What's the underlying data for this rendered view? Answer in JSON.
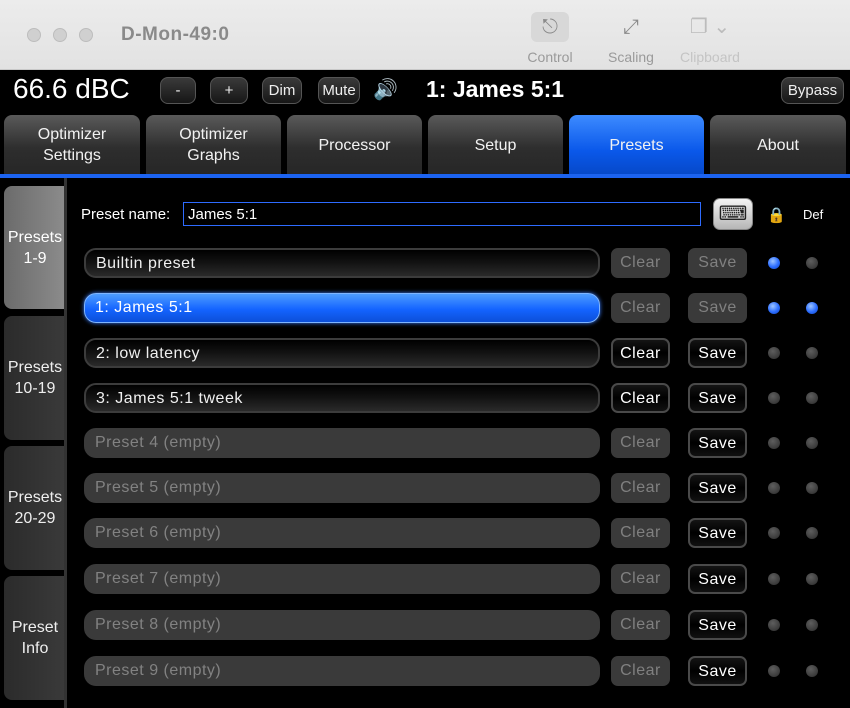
{
  "window": {
    "title": "D-Mon-49:0"
  },
  "toolbar": {
    "control_label": "Control",
    "scaling_label": "Scaling",
    "clipboard_label": "Clipboard"
  },
  "status": {
    "level": "66.6 dBC",
    "minus_label": "-",
    "plus_label": "+",
    "dim_label": "Dim",
    "mute_label": "Mute",
    "current_preset": "1: James 5:1",
    "bypass_label": "Bypass"
  },
  "tabs": [
    {
      "line1": "Optimizer",
      "line2": "Settings"
    },
    {
      "line1": "Optimizer",
      "line2": "Graphs"
    },
    {
      "line1": "Processor",
      "line2": ""
    },
    {
      "line1": "Setup",
      "line2": ""
    },
    {
      "line1": "Presets",
      "line2": ""
    },
    {
      "line1": "About",
      "line2": ""
    }
  ],
  "side_tabs": [
    {
      "line1": "Presets",
      "line2": "1-9"
    },
    {
      "line1": "Presets",
      "line2": "10-19"
    },
    {
      "line1": "Presets",
      "line2": "20-29"
    },
    {
      "line1": "Preset",
      "line2": "Info"
    }
  ],
  "preset_name": {
    "label": "Preset name:",
    "value": "James 5:1"
  },
  "column_headers": {
    "def": "Def"
  },
  "buttons": {
    "clear": "Clear",
    "save": "Save"
  },
  "presets": [
    {
      "name": "Builtin preset",
      "state": "filled",
      "clear_enabled": false,
      "save_enabled": false,
      "locked": true,
      "default": false
    },
    {
      "name": "1: James 5:1",
      "state": "selected",
      "clear_enabled": false,
      "save_enabled": false,
      "locked": true,
      "default": true
    },
    {
      "name": "2: low latency",
      "state": "filled",
      "clear_enabled": true,
      "save_enabled": true,
      "locked": false,
      "default": false
    },
    {
      "name": "3: James 5:1 tweek",
      "state": "filled",
      "clear_enabled": true,
      "save_enabled": true,
      "locked": false,
      "default": false
    },
    {
      "name": "Preset 4 (empty)",
      "state": "empty",
      "clear_enabled": false,
      "save_enabled": true,
      "locked": false,
      "default": false
    },
    {
      "name": "Preset 5 (empty)",
      "state": "empty",
      "clear_enabled": false,
      "save_enabled": true,
      "locked": false,
      "default": false
    },
    {
      "name": "Preset 6 (empty)",
      "state": "empty",
      "clear_enabled": false,
      "save_enabled": true,
      "locked": false,
      "default": false
    },
    {
      "name": "Preset 7 (empty)",
      "state": "empty",
      "clear_enabled": false,
      "save_enabled": true,
      "locked": false,
      "default": false
    },
    {
      "name": "Preset 8 (empty)",
      "state": "empty",
      "clear_enabled": false,
      "save_enabled": true,
      "locked": false,
      "default": false
    },
    {
      "name": "Preset 9 (empty)",
      "state": "empty",
      "clear_enabled": false,
      "save_enabled": true,
      "locked": false,
      "default": false
    }
  ],
  "colors": {
    "accent": "#1c63f0",
    "selected": "#1464ff"
  }
}
